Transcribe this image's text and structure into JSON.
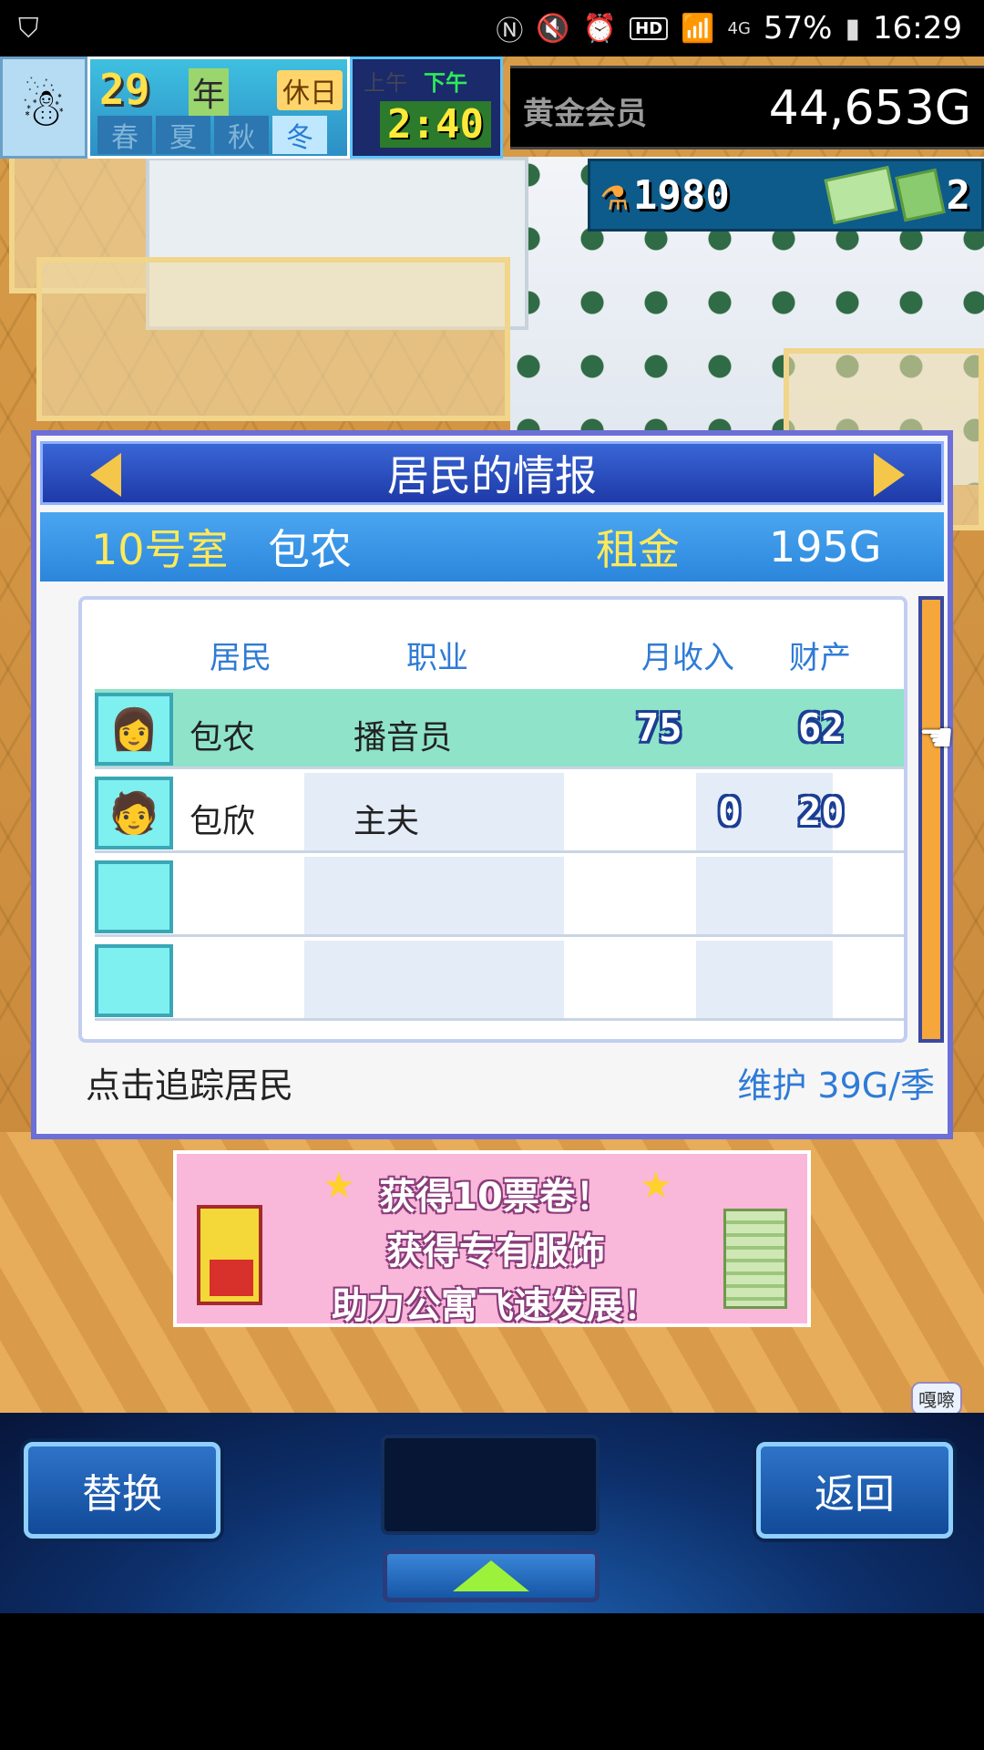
{
  "status_bar": {
    "time": "16:29",
    "battery": "57%",
    "net": "4G",
    "hd": "HD",
    "icons": [
      "shield-icon",
      "nfc-icon",
      "mute-icon",
      "alarm-icon",
      "wifi-icon",
      "signal-icon",
      "battery-icon"
    ]
  },
  "hud": {
    "year": "29",
    "year_unit": "年",
    "holiday": "休日",
    "seasons": [
      "春",
      "夏",
      "秋",
      "冬"
    ],
    "active_season": "冬",
    "am": "上午",
    "pm": "下午",
    "clock": "2:40",
    "member": "黄金会员",
    "gold": "44,653G",
    "research": "1980",
    "tickets": "2",
    "avatar_icon": "snowman-icon"
  },
  "dialog": {
    "title": "居民的情报",
    "room_no": "10号室",
    "room_name": "包农",
    "rent_label": "租金",
    "rent_value": "195G",
    "headers": {
      "resident": "居民",
      "job": "职业",
      "income": "月收入",
      "assets": "财产"
    },
    "rows": [
      {
        "name": "包农",
        "job": "播音员",
        "income": "75",
        "assets": "62",
        "selected": true
      },
      {
        "name": "包欣",
        "job": "主夫",
        "income": "0",
        "assets": "20",
        "selected": false
      },
      {
        "name": "",
        "job": "",
        "income": "",
        "assets": ""
      },
      {
        "name": "",
        "job": "",
        "income": "",
        "assets": ""
      }
    ],
    "track_hint": "点击追踪居民",
    "upkeep": "维护 39G/季"
  },
  "ad": {
    "line1": "获得10票卷！",
    "line2": "获得专有服饰",
    "line3": "助力公寓飞速发展！"
  },
  "corner_badge": "嘎嚓",
  "bottom": {
    "swap_label": "替换",
    "back_label": "返回"
  },
  "colors": {
    "dialog_title_bg": "#1e3aa8",
    "header_bg": "#2b86dc",
    "highlight_row": "#8fe3c8",
    "accent_yellow": "#ffe95a",
    "label_blue": "#2f7bd6"
  }
}
